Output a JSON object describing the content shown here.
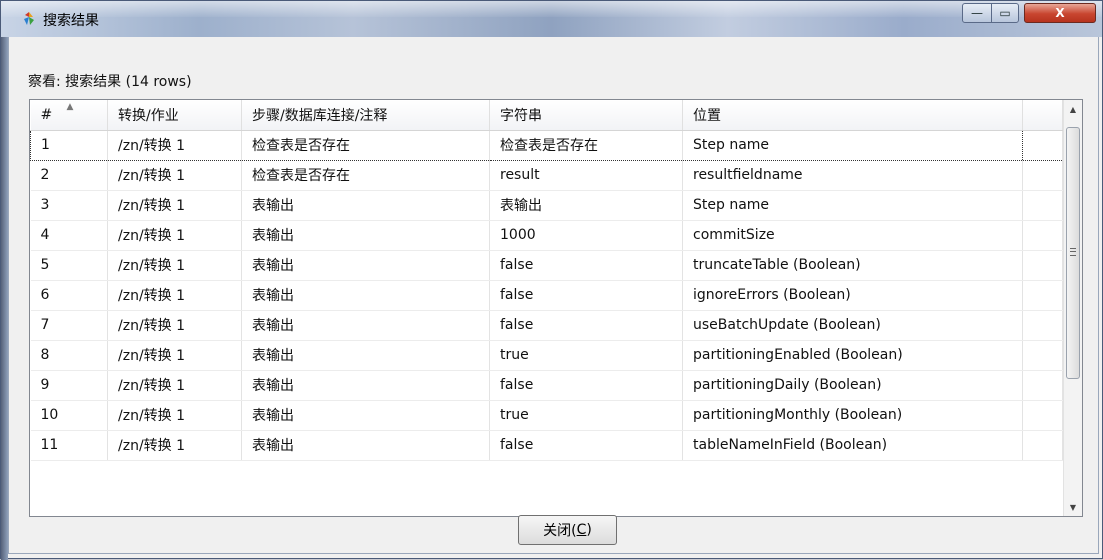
{
  "window": {
    "title": "搜索结果",
    "minimize_glyph": "—",
    "maximize_glyph": "▭",
    "close_glyph": "X"
  },
  "caption": "察看: 搜索结果 (14 rows)",
  "table": {
    "columns": [
      "#",
      "转换/作业",
      "步骤/数据库连接/注释",
      "字符串",
      "位置"
    ],
    "rows": [
      [
        "1",
        "/zn/转换 1",
        "检查表是否存在",
        "检查表是否存在",
        "Step name"
      ],
      [
        "2",
        "/zn/转换 1",
        "检查表是否存在",
        "result",
        "resultfieldname"
      ],
      [
        "3",
        "/zn/转换 1",
        "表输出",
        "表输出",
        "Step name"
      ],
      [
        "4",
        "/zn/转换 1",
        "表输出",
        "1000",
        "commitSize"
      ],
      [
        "5",
        "/zn/转换 1",
        "表输出",
        "false",
        "truncateTable (Boolean)"
      ],
      [
        "6",
        "/zn/转换 1",
        "表输出",
        "false",
        "ignoreErrors (Boolean)"
      ],
      [
        "7",
        "/zn/转换 1",
        "表输出",
        "false",
        "useBatchUpdate (Boolean)"
      ],
      [
        "8",
        "/zn/转换 1",
        "表输出",
        "true",
        "partitioningEnabled (Boolean)"
      ],
      [
        "9",
        "/zn/转换 1",
        "表输出",
        "false",
        "partitioningDaily (Boolean)"
      ],
      [
        "10",
        "/zn/转换 1",
        "表输出",
        "true",
        "partitioningMonthly (Boolean)"
      ],
      [
        "11",
        "/zn/转换 1",
        "表输出",
        "false",
        "tableNameInField (Boolean)"
      ]
    ],
    "selected_row": 1
  },
  "footer": {
    "close_label": "关闭(",
    "close_mnemonic": "C",
    "close_label_end": ")"
  },
  "colors": {
    "close_button": "#c8452f",
    "titlebar": "#9db0cc"
  }
}
